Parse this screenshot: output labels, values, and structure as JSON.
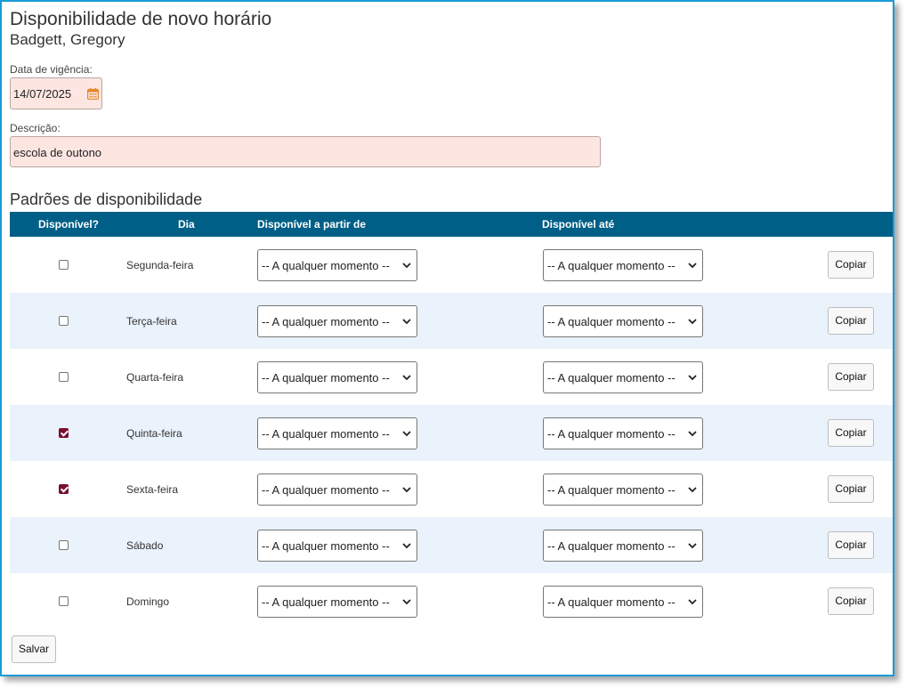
{
  "page": {
    "title": "Disponibilidade de novo horário",
    "person": "Badgett, Gregory"
  },
  "form": {
    "effective_date_label": "Data de vigência:",
    "effective_date_value": "14/07/2025",
    "description_label": "Descrição:",
    "description_value": "escola de outono"
  },
  "patterns": {
    "title": "Padrões de disponibilidade",
    "headers": {
      "available": "Disponível?",
      "day": "Dia",
      "from": "Disponível a partir de",
      "until": "Disponível até"
    },
    "rows": [
      {
        "day": "Segunda-feira",
        "checked": false,
        "from": "-- A qualquer momento --",
        "until": "-- A qualquer momento --",
        "copy": "Copiar"
      },
      {
        "day": "Terça-feira",
        "checked": false,
        "from": "-- A qualquer momento --",
        "until": "-- A qualquer momento --",
        "copy": "Copiar"
      },
      {
        "day": "Quarta-feira",
        "checked": false,
        "from": "-- A qualquer momento --",
        "until": "-- A qualquer momento --",
        "copy": "Copiar"
      },
      {
        "day": "Quinta-feira",
        "checked": true,
        "from": "-- A qualquer momento --",
        "until": "-- A qualquer momento --",
        "copy": "Copiar"
      },
      {
        "day": "Sexta-feira",
        "checked": true,
        "from": "-- A qualquer momento --",
        "until": "-- A qualquer momento --",
        "copy": "Copiar"
      },
      {
        "day": "Sábado",
        "checked": false,
        "from": "-- A qualquer momento --",
        "until": "-- A qualquer momento --",
        "copy": "Copiar"
      },
      {
        "day": "Domingo",
        "checked": false,
        "from": "-- A qualquer momento --",
        "until": "-- A qualquer momento --",
        "copy": "Copiar"
      }
    ]
  },
  "actions": {
    "save_label": "Salvar"
  },
  "colors": {
    "header_bg": "#005f87",
    "row_alt_bg": "#eaf2fb",
    "required_field_bg": "#fde6e2",
    "checkbox_checked": "#7a0f2e",
    "calendar_icon": "#e8872a",
    "frame_border": "#1a9bd7"
  },
  "icons": {
    "date_picker": "calendar-icon",
    "select_arrow": "chevron-down-icon"
  }
}
